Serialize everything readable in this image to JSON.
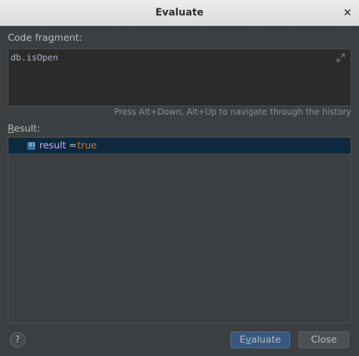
{
  "window": {
    "title": "Evaluate",
    "close_glyph": "✕"
  },
  "code_fragment": {
    "label": "Code fragment:",
    "value": "db.isOpen",
    "expand_icon": "expand-icon"
  },
  "hint": "Press Alt+Down, Alt+Up to navigate through the history",
  "result": {
    "label_mnemonic": "R",
    "label_rest": "esult:",
    "rows": [
      {
        "icon": "object-icon",
        "icon_text": "01",
        "name": "result",
        "eq": "=",
        "value": "true"
      }
    ]
  },
  "footer": {
    "help": "?",
    "evaluate_pre": "E",
    "evaluate_mnemonic": "v",
    "evaluate_post": "aluate",
    "close": "Close"
  },
  "colors": {
    "background": "#3c3f41",
    "editor_bg": "#2b2b2b",
    "selection": "#0d293e",
    "primary_button": "#365880",
    "value_keyword": "#cc7832",
    "result_name": "#d8a9f8"
  }
}
